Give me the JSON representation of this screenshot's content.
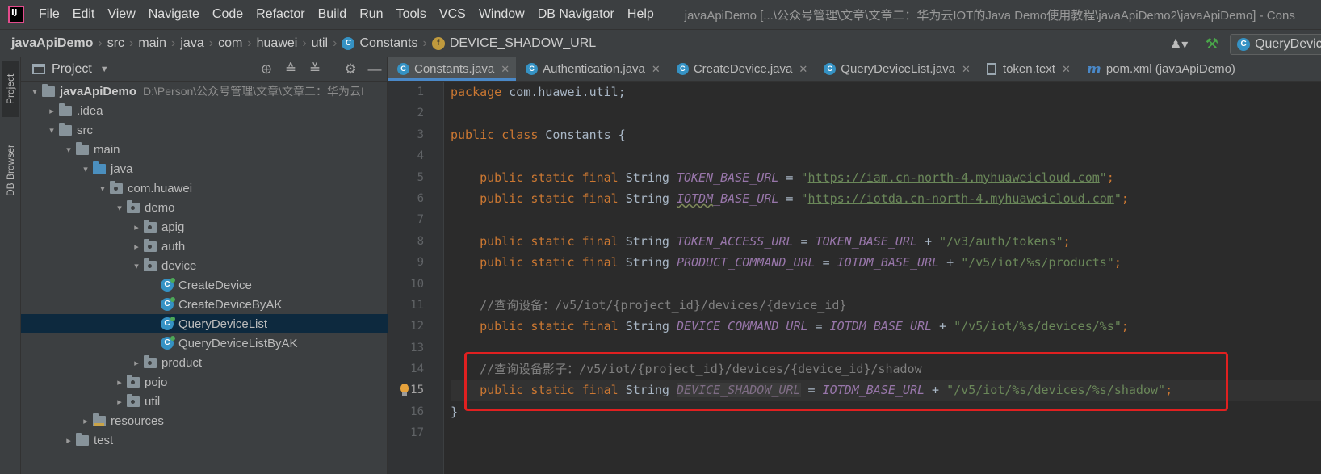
{
  "menubar": {
    "items": [
      "File",
      "Edit",
      "View",
      "Navigate",
      "Code",
      "Refactor",
      "Build",
      "Run",
      "Tools",
      "VCS",
      "Window",
      "DB Navigator",
      "Help"
    ],
    "window_title": "javaApiDemo [...\\公众号管理\\文章\\文章二：华为云IOT的Java Demo使用教程\\javaApiDemo2\\javaApiDemo] - Cons"
  },
  "breadcrumb": {
    "items": [
      "javaApiDemo",
      "src",
      "main",
      "java",
      "com",
      "huawei",
      "util",
      "Constants",
      "DEVICE_SHADOW_URL"
    ]
  },
  "run_config": {
    "label": "QueryDeviceLis"
  },
  "toolstrip": {
    "project": "Project",
    "db_browser": "DB Browser"
  },
  "project_panel": {
    "title": "Project",
    "tree": [
      {
        "label": "javaApiDemo",
        "path": "D:\\Person\\公众号管理\\文章\\文章二：华为云I",
        "depth": 0,
        "arrow": "▾",
        "icon": "folder"
      },
      {
        "label": ".idea",
        "depth": 1,
        "arrow": "▸",
        "icon": "folder"
      },
      {
        "label": "src",
        "depth": 1,
        "arrow": "▾",
        "icon": "folder"
      },
      {
        "label": "main",
        "depth": 2,
        "arrow": "▾",
        "icon": "folder"
      },
      {
        "label": "java",
        "depth": 3,
        "arrow": "▾",
        "icon": "folder-blue"
      },
      {
        "label": "com.huawei",
        "depth": 4,
        "arrow": "▾",
        "icon": "package"
      },
      {
        "label": "demo",
        "depth": 5,
        "arrow": "▾",
        "icon": "package"
      },
      {
        "label": "apig",
        "depth": 6,
        "arrow": "▸",
        "icon": "package"
      },
      {
        "label": "auth",
        "depth": 6,
        "arrow": "▸",
        "icon": "package"
      },
      {
        "label": "device",
        "depth": 6,
        "arrow": "▾",
        "icon": "package"
      },
      {
        "label": "CreateDevice",
        "depth": 7,
        "arrow": "",
        "icon": "class"
      },
      {
        "label": "CreateDeviceByAK",
        "depth": 7,
        "arrow": "",
        "icon": "class"
      },
      {
        "label": "QueryDeviceList",
        "depth": 7,
        "arrow": "",
        "icon": "class",
        "selected": true
      },
      {
        "label": "QueryDeviceListByAK",
        "depth": 7,
        "arrow": "",
        "icon": "class"
      },
      {
        "label": "product",
        "depth": 6,
        "arrow": "▸",
        "icon": "package"
      },
      {
        "label": "pojo",
        "depth": 5,
        "arrow": "▸",
        "icon": "package"
      },
      {
        "label": "util",
        "depth": 5,
        "arrow": "▸",
        "icon": "package"
      },
      {
        "label": "resources",
        "depth": 3,
        "arrow": "▸",
        "icon": "folder-res"
      },
      {
        "label": "test",
        "depth": 2,
        "arrow": "▸",
        "icon": "folder"
      }
    ]
  },
  "editor": {
    "tabs": [
      {
        "label": "Constants.java",
        "icon": "class",
        "active": true
      },
      {
        "label": "Authentication.java",
        "icon": "class"
      },
      {
        "label": "CreateDevice.java",
        "icon": "class"
      },
      {
        "label": "QueryDeviceList.java",
        "icon": "class"
      },
      {
        "label": "token.text",
        "icon": "file"
      },
      {
        "label": "pom.xml (javaApiDemo)",
        "icon": "maven"
      }
    ],
    "current_line": 15,
    "lines": [
      [
        [
          "kw",
          "package "
        ],
        [
          "plain",
          "com.huawei.util;"
        ]
      ],
      [],
      [
        [
          "kw",
          "public class "
        ],
        [
          "plain",
          "Constants {"
        ]
      ],
      [],
      [
        [
          "plain",
          "    "
        ],
        [
          "kw",
          "public static final "
        ],
        [
          "plain",
          "String "
        ],
        [
          "const",
          "TOKEN_BASE_URL"
        ],
        [
          "plain",
          " = "
        ],
        [
          "str",
          "\""
        ],
        [
          "str url",
          "https://iam.cn-north-4.myhuaweicloud.com"
        ],
        [
          "str",
          "\""
        ],
        [
          "kw",
          ";"
        ]
      ],
      [
        [
          "plain",
          "    "
        ],
        [
          "kw",
          "public static final "
        ],
        [
          "plain",
          "String "
        ],
        [
          "const warn-underline",
          "IOTDM"
        ],
        [
          "const",
          "_BASE_URL"
        ],
        [
          "plain",
          " = "
        ],
        [
          "str",
          "\""
        ],
        [
          "str url",
          "https://iotda.cn-north-4.myhuaweicloud.com"
        ],
        [
          "str",
          "\""
        ],
        [
          "kw",
          ";"
        ]
      ],
      [],
      [
        [
          "plain",
          "    "
        ],
        [
          "kw",
          "public static final "
        ],
        [
          "plain",
          "String "
        ],
        [
          "const",
          "TOKEN_ACCESS_URL"
        ],
        [
          "plain",
          " = "
        ],
        [
          "const",
          "TOKEN_BASE_URL"
        ],
        [
          "plain",
          " + "
        ],
        [
          "str",
          "\"/v3/auth/tokens\""
        ],
        [
          "kw",
          ";"
        ]
      ],
      [
        [
          "plain",
          "    "
        ],
        [
          "kw",
          "public static final "
        ],
        [
          "plain",
          "String "
        ],
        [
          "const",
          "PRODUCT_COMMAND_URL"
        ],
        [
          "plain",
          " = "
        ],
        [
          "const",
          "IOTDM_BASE_URL"
        ],
        [
          "plain",
          " + "
        ],
        [
          "str",
          "\"/v5/iot/%s/products\""
        ],
        [
          "kw",
          ";"
        ]
      ],
      [],
      [
        [
          "plain",
          "    "
        ],
        [
          "cmt",
          "//查询设备：/v5/iot/{project_id}/devices/{device_id}"
        ]
      ],
      [
        [
          "plain",
          "    "
        ],
        [
          "kw",
          "public static final "
        ],
        [
          "plain",
          "String "
        ],
        [
          "const",
          "DEVICE_COMMAND_URL"
        ],
        [
          "plain",
          " = "
        ],
        [
          "const",
          "IOTDM_BASE_URL"
        ],
        [
          "plain",
          " + "
        ],
        [
          "str",
          "\"/v5/iot/%s/devices/%s\""
        ],
        [
          "kw",
          ";"
        ]
      ],
      [],
      [
        [
          "plain",
          "    "
        ],
        [
          "cmt",
          "//查询设备影子：/v5/iot/{project_id}/devices/{device_id}/shadow"
        ]
      ],
      [
        [
          "plain",
          "    "
        ],
        [
          "kw",
          "public static final "
        ],
        [
          "plain",
          "String "
        ],
        [
          "const hl-var",
          "DEVICE_SHADOW_URL"
        ],
        [
          "plain",
          " = "
        ],
        [
          "const",
          "IOTDM_BASE_URL"
        ],
        [
          "plain",
          " + "
        ],
        [
          "str",
          "\"/v5/iot/%s/devices/%s/shadow\""
        ],
        [
          "kw",
          ";"
        ]
      ],
      [
        [
          "plain",
          "}"
        ]
      ],
      []
    ]
  }
}
